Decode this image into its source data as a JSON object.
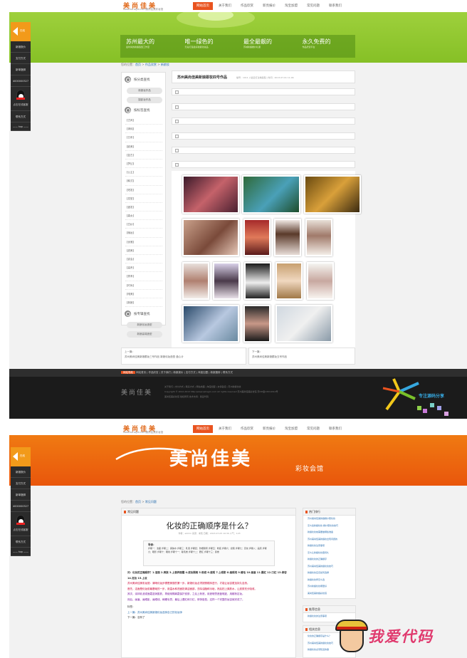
{
  "shared": {
    "logo": "美尚佳美",
    "logo_sub": "www.aznsgm.com美尚佳美彩妆馆",
    "nav": [
      "网站首页",
      "关于我们",
      "作品欣赏",
      "新亮报价",
      "淘宝加盟",
      "常见问题",
      "联系我们"
    ],
    "float_sidebar": {
      "header": "在线",
      "items": [
        "新娘报价",
        "支付方式",
        "新单捆绑",
        "4000000527"
      ],
      "qq_label": "点击在线客服",
      "contact": "联系方式",
      "bottom": "—— top ——"
    }
  },
  "page_a": {
    "slogans": [
      {
        "title": "苏州最大的",
        "sub": "最时尚的新娘造型工作室"
      },
      {
        "title": "唯一绿色的",
        "sub": "无毒打造最好新娘化妆品"
      },
      {
        "title": "最全最靓的",
        "sub": "苏城新娘婚纱礼服"
      },
      {
        "title": "永久免费的",
        "sub": "作品托管平台"
      }
    ],
    "breadcrumb": {
      "prefix": "您的位置：",
      "home": "首页",
      "sep": ">",
      "cat": "作品欣赏",
      "sep2": ">",
      "sub": "新娘妆"
    },
    "left_panel": {
      "head1": "按分类查找",
      "pills1": [
        "新娘妆作品",
        "摄影妆作品"
      ],
      "head2": "按标签查找",
      "tags": [
        "【古风】",
        "【清纯】",
        "【日系】",
        "【欧美】",
        "【复古】",
        "【梦幻】",
        "【公主】",
        "【韩式】",
        "【短发】",
        "【发型】",
        "【盘发】",
        "【森女】",
        "【白纱】",
        "【晚妆】",
        "【优雅】",
        "【甜美】",
        "【宴会】",
        "【高贵】",
        "【秀禾】",
        "【时尚】",
        "【唯美】",
        "【新娘】"
      ],
      "head3": "按专辑查找",
      "pills3": [
        "新娘化妆造型",
        "新娘高端造型"
      ]
    },
    "main_title": "苏州美尚佳美新娘跟妆四号作品",
    "main_meta": "编号：1011 人最近打过她造型 | 时间：2013-07-01 11:46",
    "pager": {
      "prev_label": "上一篇：",
      "prev_text": "苏州美尚佳美新娘跟妆三号作品 新娘化妆造型 盘心计",
      "next_label": "下一篇：",
      "next_text": "苏州美尚佳美新娘跟妆五号作品"
    },
    "footer": {
      "tag": "网站导航",
      "links": "网站首页 | 作品欣赏 | 关于我们 | 新娘报价 | 支付方式 | 淘宝加盟 | 新娘捆绑 | 联系方式",
      "logo": "美尚佳美",
      "lines": [
        "关于我们 | 支付方式 | 联系方式 | 网站地图 | 淘宝加盟 | 友情链接 | 苏州新娘化妆",
        "Copyright © 2012-2013 http://www.aznsgm.com All rights reserved 苏州美尚佳美彩妆馆 苏ICP备13014312号",
        "美尚佳美彩妆馆 版权所有 技术支持：我爱代码"
      ],
      "brand": "专注源码分享"
    }
  },
  "page_b": {
    "banner_title": "美尚佳美",
    "banner_sub": "彩妆会馆",
    "breadcrumb": {
      "prefix": "您的位置：",
      "home": "首页",
      "sep": ">",
      "cat": "常见问题"
    },
    "section": "常见问题",
    "article_title": "化妆的正确顺序是什么？",
    "article_meta": "作者：admin 来源：未知 日期：2013-07-05 10:39 人气：123",
    "summary_label": "导读：",
    "summary": "步骤一：洁面 步骤二：爽肤水 步骤三：乳液 步骤四：防晒隔离 步骤五：粉底 步骤六：遮瑕 步骤七：定妆 步骤八：画眉 步骤九：眼影 步骤十：眼线 步骤十一：睫毛膏 步骤十二：腮红 步骤十三：唇膏",
    "body_lines": [
      "问：化妆的正确顺序？1.洁面 2.爽肤 3.上营养面霜 4.底妆隔离 5.粉底 6.遮瑕 7.上眼影 8.画眼线 9.睫毛 10.画眉 11.腮红 12.口红 13.修容 14.定妆 15.上妆",
      "苏州美尚佳美彩妆馆：清晰化妆步骤是美丽的第一步。新娘化妆必须按照顺序进行，才能让妆容更加持久自然。",
      "首先，洁面是化妆前最基础的一步，用温水和洗面奶清洁面部，去除油脂和污垢，然后拍上爽肤水，让皮肤充分吸收。",
      "其次，涂抹乳液或面霜滋润肌肤，再使用隔离霜保护皮肤，之后上粉底，用遮瑕膏遮盖瑕疵，用散粉定妆。",
      "然后，画眉、画眼影、画眼线、刷睫毛膏，最后上腮红和口红，修饰脸型。这样一个完整的妆容就完成了。"
    ],
    "tags_label": "标签：",
    "prev": "上一篇：苏州美尚佳美新娘化妆选择自己的化妆师",
    "next": "下一篇：没有了",
    "hot_title": "热门排行",
    "hot": [
      "苏州美尚佳美新娘婚纱照化妆",
      "怎么给新娘化妆 婚纱照化妆技巧",
      "新娘化妆前需要做哪些准备",
      "苏州美尚佳美新娘妆出现问题的",
      "新娘化妆注意事项",
      "怎么让新娘化妆更持久",
      "新娘化妆的正确顺序",
      "苏州美尚佳美新娘化妆技巧",
      "新娘化妆应该如何选择",
      "新娘化妆师怎么选",
      "苏州新娘化妆哪里好",
      "美尚佳美新娘彩妆馆"
    ],
    "rec_title": "推荐信息",
    "rec": [
      "新娘化妆的注意事项"
    ],
    "rel_title": "相关信息",
    "rel": [
      "化妆的正确顺序是什么？",
      "苏州美尚佳美新娘化妆技巧",
      "新娘化妆必须知道的事"
    ],
    "watermark": "我爱代码"
  }
}
